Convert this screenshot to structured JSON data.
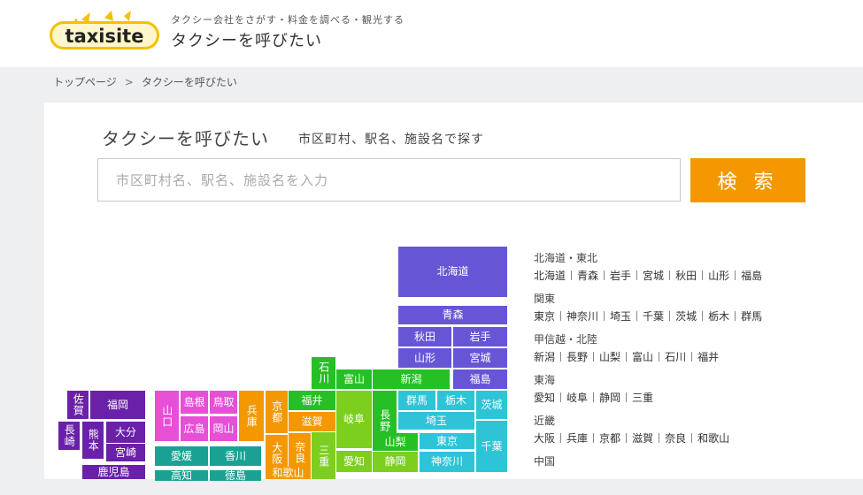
{
  "header": {
    "logo_text": "taxisite",
    "tagline": "タクシー会社をさがす・料金を調べる・観光する",
    "title": "タクシーを呼びたい"
  },
  "breadcrumb": {
    "items": [
      "トップページ",
      "タクシーを呼びたい"
    ],
    "separator": ">"
  },
  "search": {
    "title": "タクシーを呼びたい",
    "subtitle": "市区町村、駅名、施設名で探す",
    "placeholder": "市区町村名、駅名、施設名を入力",
    "button_label": "検 索"
  },
  "colors": {
    "accent": "#f39800",
    "hokkaido_tohoku": "#6656d6",
    "kanto": "#2ec4d8",
    "koshinetsu_hokuriku": "#26c026",
    "hokuriku_light": "#8edb26",
    "tokai": "#7ccf1e",
    "kinki": "#f39800",
    "chugoku": "#e64fd6",
    "shikoku": "#1aa193",
    "kyushu": "#6a20a8"
  },
  "map": {
    "prefectures": [
      {
        "id": "hokkaido",
        "name": "北海道",
        "color": "hokkaido_tohoku"
      },
      {
        "id": "aomori",
        "name": "青森",
        "color": "hokkaido_tohoku"
      },
      {
        "id": "akita",
        "name": "秋田",
        "color": "hokkaido_tohoku"
      },
      {
        "id": "iwate",
        "name": "岩手",
        "color": "hokkaido_tohoku"
      },
      {
        "id": "yamagata",
        "name": "山形",
        "color": "hokkaido_tohoku"
      },
      {
        "id": "miyagi",
        "name": "宮城",
        "color": "hokkaido_tohoku"
      },
      {
        "id": "fukushima",
        "name": "福島",
        "color": "hokkaido_tohoku"
      },
      {
        "id": "niigata",
        "name": "新潟",
        "color": "koshinetsu_hokuriku"
      },
      {
        "id": "ishikawa",
        "name": "石川",
        "color": "koshinetsu_hokuriku"
      },
      {
        "id": "toyama",
        "name": "富山",
        "color": "koshinetsu_hokuriku"
      },
      {
        "id": "fukui",
        "name": "福井",
        "color": "koshinetsu_hokuriku"
      },
      {
        "id": "nagano",
        "name": "長野",
        "color": "koshinetsu_hokuriku"
      },
      {
        "id": "yamanashi",
        "name": "山梨",
        "color": "koshinetsu_hokuriku"
      },
      {
        "id": "gunma",
        "name": "群馬",
        "color": "kanto"
      },
      {
        "id": "tochigi",
        "name": "栃木",
        "color": "kanto"
      },
      {
        "id": "ibaraki",
        "name": "茨城",
        "color": "kanto"
      },
      {
        "id": "saitama",
        "name": "埼玉",
        "color": "kanto"
      },
      {
        "id": "tokyo",
        "name": "東京",
        "color": "kanto"
      },
      {
        "id": "chiba",
        "name": "千葉",
        "color": "kanto"
      },
      {
        "id": "kanagawa",
        "name": "神奈川",
        "color": "kanto"
      },
      {
        "id": "gifu",
        "name": "岐阜",
        "color": "tokai"
      },
      {
        "id": "shizuoka",
        "name": "静岡",
        "color": "tokai"
      },
      {
        "id": "aichi",
        "name": "愛知",
        "color": "tokai"
      },
      {
        "id": "mie",
        "name": "三重",
        "color": "tokai"
      },
      {
        "id": "shiga",
        "name": "滋賀",
        "color": "kinki"
      },
      {
        "id": "kyoto",
        "name": "京都",
        "color": "kinki"
      },
      {
        "id": "hyogo",
        "name": "兵庫",
        "color": "kinki"
      },
      {
        "id": "osaka",
        "name": "大阪",
        "color": "kinki"
      },
      {
        "id": "nara",
        "name": "奈良",
        "color": "kinki"
      },
      {
        "id": "wakayama",
        "name": "和歌山",
        "color": "kinki"
      },
      {
        "id": "tottori",
        "name": "鳥取",
        "color": "chugoku"
      },
      {
        "id": "shimane",
        "name": "島根",
        "color": "chugoku"
      },
      {
        "id": "okayama",
        "name": "岡山",
        "color": "chugoku"
      },
      {
        "id": "hiroshima",
        "name": "広島",
        "color": "chugoku"
      },
      {
        "id": "yamaguchi",
        "name": "山口",
        "color": "chugoku"
      },
      {
        "id": "ehime",
        "name": "愛媛",
        "color": "shikoku"
      },
      {
        "id": "kagawa",
        "name": "香川",
        "color": "shikoku"
      },
      {
        "id": "kochi",
        "name": "高知",
        "color": "shikoku"
      },
      {
        "id": "tokushima",
        "name": "徳島",
        "color": "shikoku"
      },
      {
        "id": "fukuoka",
        "name": "福岡",
        "color": "kyushu"
      },
      {
        "id": "saga",
        "name": "佐賀",
        "color": "kyushu"
      },
      {
        "id": "nagasaki",
        "name": "長崎",
        "color": "kyushu"
      },
      {
        "id": "kumamoto",
        "name": "熊本",
        "color": "kyushu"
      },
      {
        "id": "oita",
        "name": "大分",
        "color": "kyushu"
      },
      {
        "id": "miyazaki",
        "name": "宮崎",
        "color": "kyushu"
      },
      {
        "id": "kagoshima",
        "name": "鹿児島",
        "color": "kyushu"
      }
    ]
  },
  "regions": [
    {
      "name": "北海道・東北",
      "prefectures": [
        "北海道",
        "青森",
        "岩手",
        "宮城",
        "秋田",
        "山形",
        "福島"
      ]
    },
    {
      "name": "関東",
      "prefectures": [
        "東京",
        "神奈川",
        "埼玉",
        "千葉",
        "茨城",
        "栃木",
        "群馬"
      ]
    },
    {
      "name": "甲信越・北陸",
      "prefectures": [
        "新潟",
        "長野",
        "山梨",
        "富山",
        "石川",
        "福井"
      ]
    },
    {
      "name": "東海",
      "prefectures": [
        "愛知",
        "岐阜",
        "静岡",
        "三重"
      ]
    },
    {
      "name": "近畿",
      "prefectures": [
        "大阪",
        "兵庫",
        "京都",
        "滋賀",
        "奈良",
        "和歌山"
      ]
    },
    {
      "name": "中国",
      "prefectures": []
    }
  ]
}
